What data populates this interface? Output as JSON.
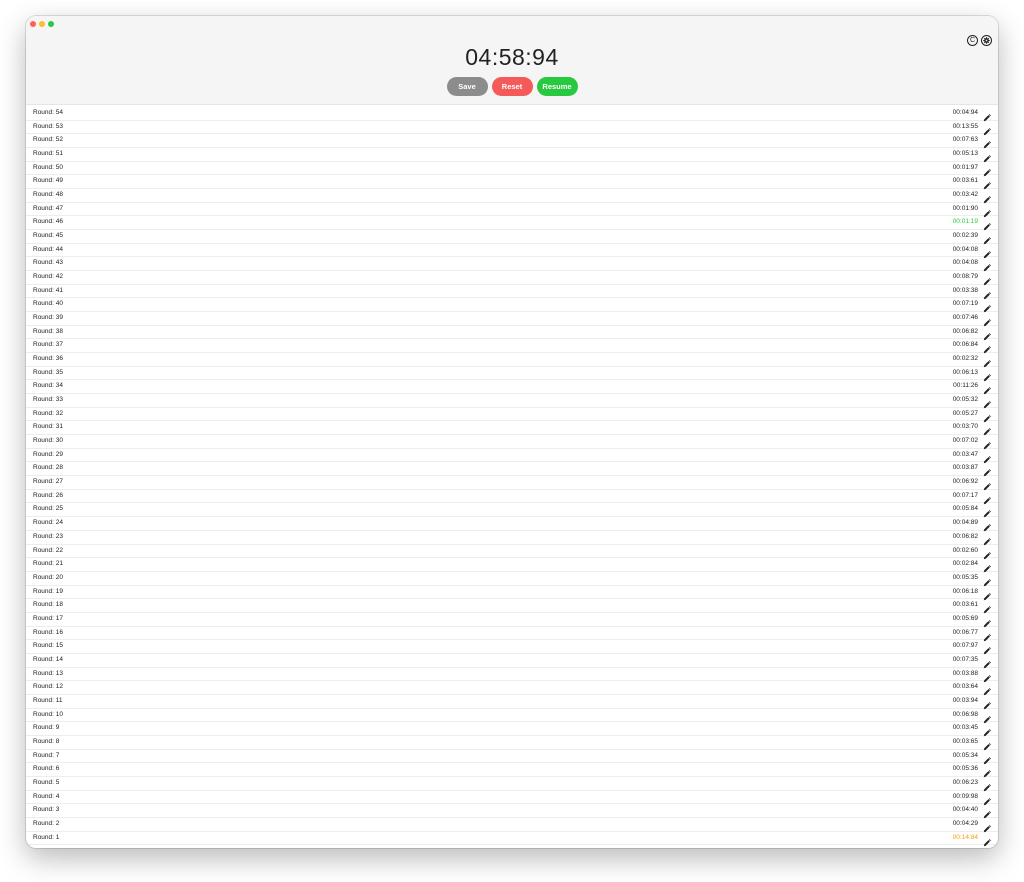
{
  "window": {
    "traffic": [
      "close",
      "minimize",
      "maximize"
    ]
  },
  "header": {
    "timer": "04:58:94",
    "icons": [
      "copyright-icon",
      "gear-icon"
    ],
    "copyright_glyph": "C",
    "buttons": {
      "save_label": "Save",
      "reset_label": "Reset",
      "resume_label": "Resume"
    }
  },
  "colors": {
    "fastest": "#28c840",
    "slowest": "#f5a000",
    "save": "#8c8c8c",
    "reset": "#f55a5a",
    "resume": "#28c840"
  },
  "rounds": [
    {
      "label": "Round: 54",
      "time": "00:04:94",
      "status": "normal"
    },
    {
      "label": "Round: 53",
      "time": "00:13:55",
      "status": "normal"
    },
    {
      "label": "Round: 52",
      "time": "00:07:63",
      "status": "normal"
    },
    {
      "label": "Round: 51",
      "time": "00:05:13",
      "status": "normal"
    },
    {
      "label": "Round: 50",
      "time": "00:01:97",
      "status": "normal"
    },
    {
      "label": "Round: 49",
      "time": "00:03:61",
      "status": "normal"
    },
    {
      "label": "Round: 48",
      "time": "00:03:42",
      "status": "normal"
    },
    {
      "label": "Round: 47",
      "time": "00:01:90",
      "status": "normal"
    },
    {
      "label": "Round: 46",
      "time": "00:01:19",
      "status": "fastest"
    },
    {
      "label": "Round: 45",
      "time": "00:02:39",
      "status": "normal"
    },
    {
      "label": "Round: 44",
      "time": "00:04:08",
      "status": "normal"
    },
    {
      "label": "Round: 43",
      "time": "00:04:08",
      "status": "normal"
    },
    {
      "label": "Round: 42",
      "time": "00:08:79",
      "status": "normal"
    },
    {
      "label": "Round: 41",
      "time": "00:03:38",
      "status": "normal"
    },
    {
      "label": "Round: 40",
      "time": "00:07:19",
      "status": "normal"
    },
    {
      "label": "Round: 39",
      "time": "00:07:46",
      "status": "normal"
    },
    {
      "label": "Round: 38",
      "time": "00:06:82",
      "status": "normal"
    },
    {
      "label": "Round: 37",
      "time": "00:06:84",
      "status": "normal"
    },
    {
      "label": "Round: 36",
      "time": "00:02:32",
      "status": "normal"
    },
    {
      "label": "Round: 35",
      "time": "00:06:13",
      "status": "normal"
    },
    {
      "label": "Round: 34",
      "time": "00:11:26",
      "status": "normal"
    },
    {
      "label": "Round: 33",
      "time": "00:05:32",
      "status": "normal"
    },
    {
      "label": "Round: 32",
      "time": "00:05:27",
      "status": "normal"
    },
    {
      "label": "Round: 31",
      "time": "00:03:70",
      "status": "normal"
    },
    {
      "label": "Round: 30",
      "time": "00:07:02",
      "status": "normal"
    },
    {
      "label": "Round: 29",
      "time": "00:03:47",
      "status": "normal"
    },
    {
      "label": "Round: 28",
      "time": "00:03:87",
      "status": "normal"
    },
    {
      "label": "Round: 27",
      "time": "00:06:92",
      "status": "normal"
    },
    {
      "label": "Round: 26",
      "time": "00:07:17",
      "status": "normal"
    },
    {
      "label": "Round: 25",
      "time": "00:05:84",
      "status": "normal"
    },
    {
      "label": "Round: 24",
      "time": "00:04:89",
      "status": "normal"
    },
    {
      "label": "Round: 23",
      "time": "00:06:82",
      "status": "normal"
    },
    {
      "label": "Round: 22",
      "time": "00:02:60",
      "status": "normal"
    },
    {
      "label": "Round: 21",
      "time": "00:02:84",
      "status": "normal"
    },
    {
      "label": "Round: 20",
      "time": "00:05:35",
      "status": "normal"
    },
    {
      "label": "Round: 19",
      "time": "00:06:18",
      "status": "normal"
    },
    {
      "label": "Round: 18",
      "time": "00:03:61",
      "status": "normal"
    },
    {
      "label": "Round: 17",
      "time": "00:05:69",
      "status": "normal"
    },
    {
      "label": "Round: 16",
      "time": "00:06:77",
      "status": "normal"
    },
    {
      "label": "Round: 15",
      "time": "00:07:97",
      "status": "normal"
    },
    {
      "label": "Round: 14",
      "time": "00:07:35",
      "status": "normal"
    },
    {
      "label": "Round: 13",
      "time": "00:03:88",
      "status": "normal"
    },
    {
      "label": "Round: 12",
      "time": "00:03:64",
      "status": "normal"
    },
    {
      "label": "Round: 11",
      "time": "00:03:94",
      "status": "normal"
    },
    {
      "label": "Round: 10",
      "time": "00:06:98",
      "status": "normal"
    },
    {
      "label": "Round: 9",
      "time": "00:03:45",
      "status": "normal"
    },
    {
      "label": "Round: 8",
      "time": "00:03:65",
      "status": "normal"
    },
    {
      "label": "Round: 7",
      "time": "00:05:34",
      "status": "normal"
    },
    {
      "label": "Round: 6",
      "time": "00:05:36",
      "status": "normal"
    },
    {
      "label": "Round: 5",
      "time": "00:06:23",
      "status": "normal"
    },
    {
      "label": "Round: 4",
      "time": "00:09:98",
      "status": "normal"
    },
    {
      "label": "Round: 3",
      "time": "00:04:40",
      "status": "normal"
    },
    {
      "label": "Round: 2",
      "time": "00:04:29",
      "status": "normal"
    },
    {
      "label": "Round: 1",
      "time": "00:14:84",
      "status": "slowest"
    }
  ]
}
